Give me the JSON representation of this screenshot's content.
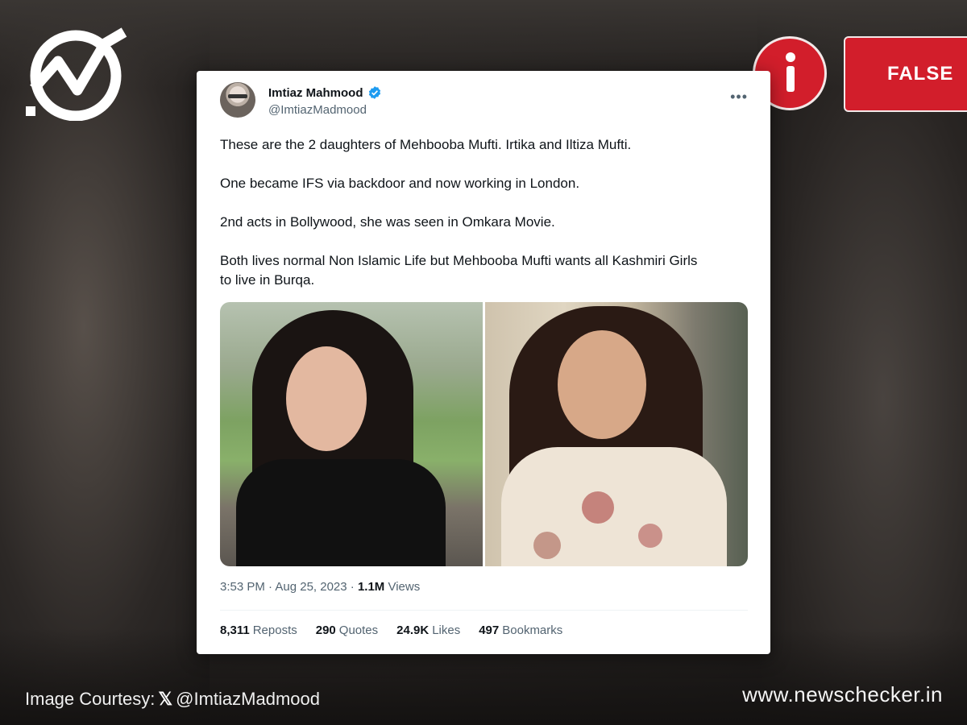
{
  "badges": {
    "verdict": "FALSE"
  },
  "tweet": {
    "author_name": "Imtiaz Mahmood",
    "author_handle": "@ImtiazMadmood",
    "more_label": "•••",
    "paragraphs": [
      "These are the 2 daughters of Mehbooba Mufti. Irtika and Iltiza Mufti.",
      "One became IFS via backdoor and now working in London.",
      "2nd acts in Bollywood, she was seen in Omkara Movie.",
      "Both lives normal Non Islamic Life but Mehbooba Mufti wants all Kashmiri Girls to live in Burqa."
    ],
    "timestamp": "3:53 PM · Aug 25, 2023 · ",
    "views_count": "1.1M",
    "views_label": " Views",
    "stats": [
      {
        "count": "8,311",
        "label": "Reposts"
      },
      {
        "count": "290",
        "label": "Quotes"
      },
      {
        "count": "24.9K",
        "label": "Likes"
      },
      {
        "count": "497",
        "label": "Bookmarks"
      }
    ]
  },
  "footer": {
    "courtesy_prefix": "Image Courtesy:",
    "courtesy_x": "𝕏",
    "courtesy_handle": "@ImtiazMadmood",
    "site_url": "www.newschecker.in"
  },
  "colors": {
    "badge_red": "#d21e2b",
    "verified_blue": "#1d9bf0"
  }
}
